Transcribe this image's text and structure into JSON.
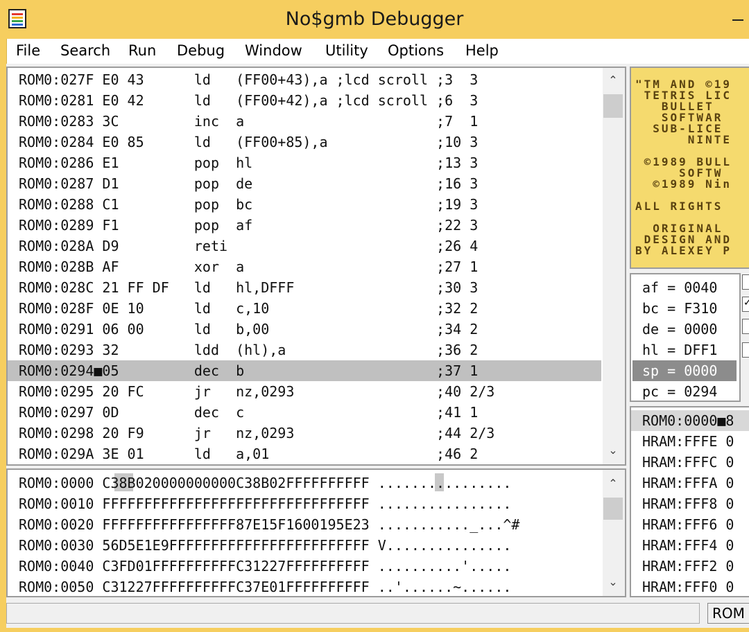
{
  "window": {
    "title": "No$gmb Debugger"
  },
  "menu": [
    "File",
    "Search",
    "Run",
    "Debug",
    "Window",
    "Utility",
    "Options",
    "Help"
  ],
  "disassembly": [
    "ROM0:027F E0 43      ld   (FF00+43),a ;lcd scroll ;3  3",
    "ROM0:0281 E0 42      ld   (FF00+42),a ;lcd scroll ;6  3",
    "ROM0:0283 3C         inc  a                       ;7  1",
    "ROM0:0284 E0 85      ld   (FF00+85),a             ;10 3",
    "ROM0:0286 E1         pop  hl                      ;13 3",
    "ROM0:0287 D1         pop  de                      ;16 3",
    "ROM0:0288 C1         pop  bc                      ;19 3",
    "ROM0:0289 F1         pop  af                      ;22 3",
    "ROM0:028A D9         reti                         ;26 4",
    "ROM0:028B AF         xor  a                       ;27 1",
    "ROM0:028C 21 FF DF   ld   hl,DFFF                 ;30 3",
    "ROM0:028F 0E 10      ld   c,10                    ;32 2",
    "ROM0:0291 06 00      ld   b,00                    ;34 2",
    "ROM0:0293 32         ldd  (hl),a                  ;36 2",
    "ROM0:0294■05         dec  b                       ;37 1",
    "ROM0:0295 20 FC      jr   nz,0293                 ;40 2/3",
    "ROM0:0297 0D         dec  c                       ;41 1",
    "ROM0:0298 20 F9      jr   nz,0293                 ;44 2/3",
    "ROM0:029A 3E 01      ld   a,01                    ;46 2"
  ],
  "hexdump": [
    "ROM0:0000 C38B020000000000C38B02FFFFFFFFFF ................",
    "ROM0:0010 FFFFFFFFFFFFFFFFFFFFFFFFFFFFFFFF ................",
    "ROM0:0020 FFFFFFFFFFFFFFFF87E15F1600195E23 ..........._...^#",
    "ROM0:0030 56D5E1E9FFFFFFFFFFFFFFFFFFFFFFFF V...............",
    "ROM0:0040 C3FD01FFFFFFFFFFC31227FFFFFFFFFF ..........'.....",
    "ROM0:0050 C31227FFFFFFFFFFC37E01FFFFFFFFFF ..'......~......"
  ],
  "gb_screen": [
    "\"TM AND ©19",
    " TETRIS LIC",
    "   BULLET ",
    "   SOFTWAR",
    "  SUB-LICE",
    "      NINTE",
    "",
    " ©1989 BULL",
    "     SOFTW",
    "  ©1989 Nin",
    "",
    "ALL RIGHTS ",
    "",
    "  ORIGINAL ",
    " DESIGN AND",
    "BY ALEXEY P"
  ],
  "registers": [
    "af = 0040",
    "bc = F310",
    "de = 0000",
    "hl = DFF1",
    "sp = 0000",
    "pc = 0294"
  ],
  "stack": [
    "ROM0:0000■8",
    "HRAM:FFFE 0",
    "HRAM:FFFC 0",
    "HRAM:FFFA 0",
    "HRAM:FFF8 0",
    "HRAM:FFF6 0",
    "HRAM:FFF4 0",
    "HRAM:FFF2 0",
    "HRAM:FFF0 0"
  ],
  "status": {
    "mode": "ROM ("
  },
  "colors": {
    "titlebar": "#f6ce5f",
    "highlight_row": "#c0c0c0",
    "sp_highlight": "#8c8c8c",
    "gb_screen": "#f5da6e"
  }
}
